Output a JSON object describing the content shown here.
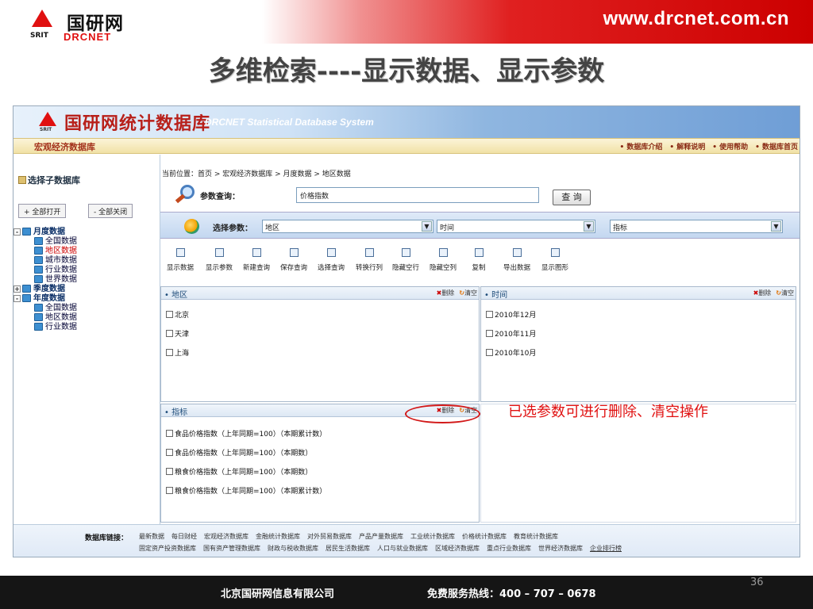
{
  "slide": {
    "url": "www.drcnet.com.cn",
    "logo_cn": "国研网",
    "logo_en": "DRCNET",
    "logo_srit": "SRIT",
    "title": "多维检索----显示数据、显示参数",
    "page_number": "36",
    "footer_company": "北京国研网信息有限公司",
    "footer_hotline": "免费服务热线：400 – 707 – 0678"
  },
  "app": {
    "title_cn": "国研网统计数据库",
    "title_en": "DRCNET Statistical Database System",
    "logo_srit": "SRIT",
    "subtitle": "宏观经济数据库",
    "top_links": [
      "• 数据库介绍",
      "• 解释说明",
      "• 使用帮助",
      "• 数据库首页"
    ]
  },
  "sidebar": {
    "heading": "选择子数据库",
    "open_all": "+ 全部打开",
    "close_all": "- 全部关闭",
    "tree": [
      {
        "label": "月度数据",
        "level": 1,
        "pm": "-"
      },
      {
        "label": "全国数据",
        "level": 2
      },
      {
        "label": "地区数据",
        "level": 2,
        "selected": true
      },
      {
        "label": "城市数据",
        "level": 2
      },
      {
        "label": "行业数据",
        "level": 2
      },
      {
        "label": "世界数据",
        "level": 2
      },
      {
        "label": "季度数据",
        "level": 1,
        "pm": "+"
      },
      {
        "label": "年度数据",
        "level": 1,
        "pm": "-"
      },
      {
        "label": "全国数据",
        "level": 2
      },
      {
        "label": "地区数据",
        "level": 2
      },
      {
        "label": "行业数据",
        "level": 2
      }
    ]
  },
  "main": {
    "breadcrumb": "当前位置：首页 > 宏观经济数据库 > 月度数据 > 地区数据",
    "query_label": "参数查询：",
    "query_value": "价格指数",
    "query_button": "查 询",
    "param_label": "选择参数：",
    "selects": [
      "地区",
      "时间",
      "指标"
    ],
    "toolbar": [
      "显示数据",
      "显示参数",
      "新建查询",
      "保存查询",
      "选择查询",
      "转换行列",
      "隐藏空行",
      "隐藏空列",
      "复制",
      "导出数据",
      "显示图形"
    ],
    "panels": {
      "region": {
        "title": "• 地区",
        "delete": "删除",
        "clear": "清空",
        "items": [
          "北京",
          "天津",
          "上海"
        ]
      },
      "time": {
        "title": "• 时间",
        "delete": "删除",
        "clear": "清空",
        "items": [
          "2010年12月",
          "2010年11月",
          "2010年10月"
        ]
      },
      "indicator": {
        "title": "• 指标",
        "delete": "删除",
        "clear": "清空",
        "items": [
          "食品价格指数（上年同期=100）（本期累计数）",
          "食品价格指数（上年同期=100）（本期数）",
          "粮食价格指数（上年同期=100）（本期数）",
          "粮食价格指数（上年同期=100）（本期累计数）"
        ]
      }
    },
    "callout": "已选参数可进行删除、清空操作"
  },
  "footer_links": {
    "label": "数据库链接：",
    "row1": [
      "最新数据",
      "每日财经",
      "宏观经济数据库",
      "金融统计数据库",
      "对外贸易数据库",
      "产品产量数据库",
      "工业统计数据库",
      "价格统计数据库",
      "教育统计数据库"
    ],
    "row2": [
      "固定资产投资数据库",
      "国有资产管理数据库",
      "财政与税收数据库",
      "居民生活数据库",
      "人口与就业数据库",
      "区域经济数据库",
      "重点行业数据库",
      "世界经济数据库",
      "企业排行榜"
    ]
  },
  "colors": {
    "brand_red": "#e01010",
    "app_blue": "#6f9ed6"
  }
}
